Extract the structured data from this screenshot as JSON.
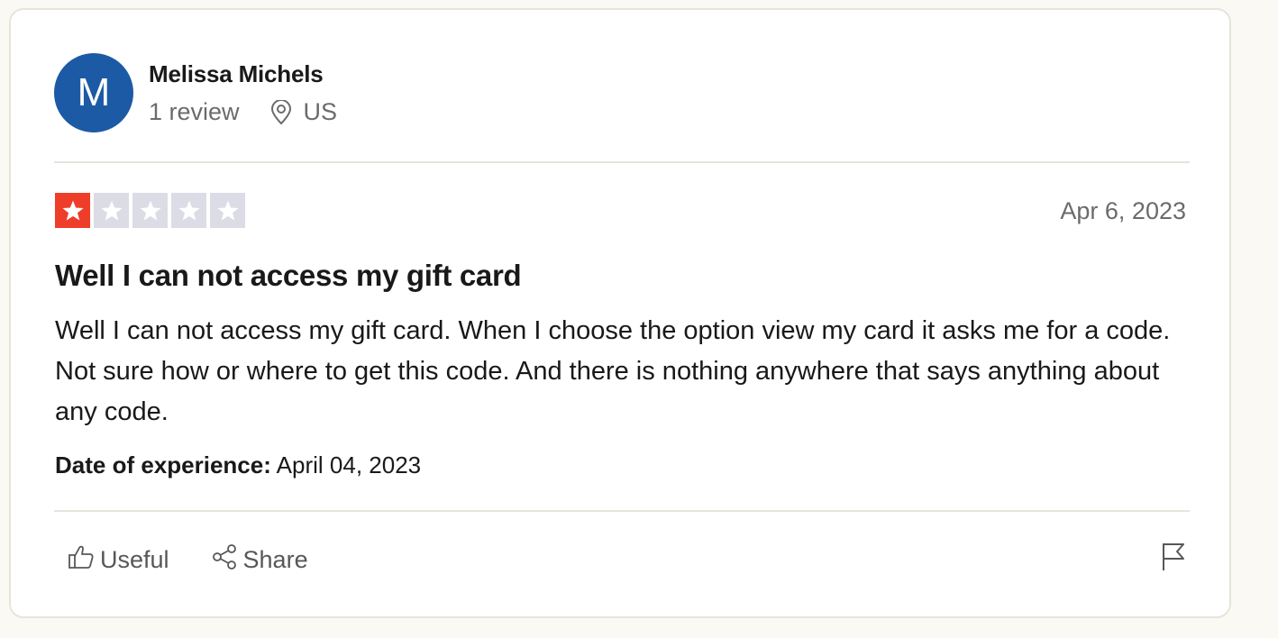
{
  "reviewer": {
    "initial": "M",
    "name": "Melissa Michels",
    "review_count": "1 review",
    "location": "US",
    "avatar_color": "#1c5aa6"
  },
  "review": {
    "rating": 1,
    "max_rating": 5,
    "star_active_color": "#ee3e2a",
    "star_inactive_color": "#dcdce6",
    "date": "Apr 6, 2023",
    "title": "Well I can not access my gift card",
    "body": "Well I can not access my gift card. When I choose the option view my card it asks me for a code. Not sure how or where to get this code. And there is nothing anywhere that says anything about any code.",
    "experience_label": "Date of experience:",
    "experience_date": "April 04, 2023"
  },
  "actions": {
    "useful_label": "Useful",
    "useful_icon": "thumbs-up-icon",
    "share_label": "Share",
    "share_icon": "share-icon",
    "report_icon": "flag-icon"
  }
}
